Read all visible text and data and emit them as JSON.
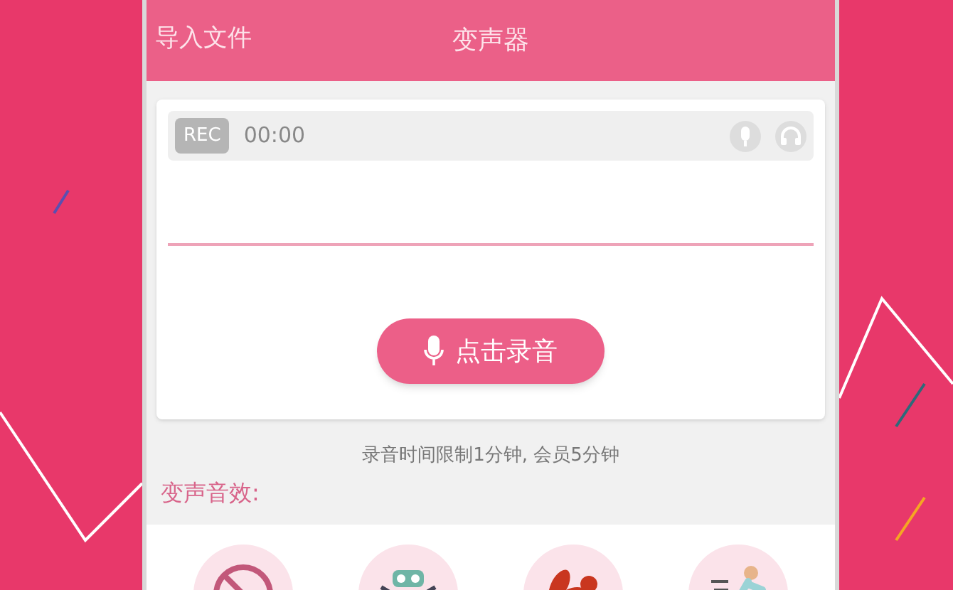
{
  "header": {
    "left_action": "导入文件",
    "title": "变声器"
  },
  "recorder": {
    "badge": "REC",
    "time": "00:00",
    "record_button": "点击录音"
  },
  "limit_note": "录音时间限制1分钟, 会员5分钟",
  "effects_heading": "变声音效:",
  "effects": [
    {
      "kind": "none"
    },
    {
      "kind": "robot"
    },
    {
      "kind": "squirrel"
    },
    {
      "kind": "runner"
    }
  ]
}
